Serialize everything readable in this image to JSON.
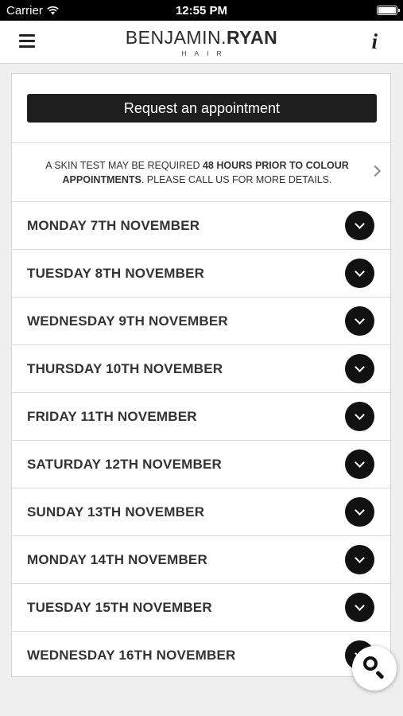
{
  "status_bar": {
    "carrier": "Carrier",
    "time": "12:55 PM"
  },
  "header": {
    "logo_first": "BENJAMIN.",
    "logo_second": "RYAN",
    "logo_sub": "HAIR",
    "info_glyph": "i"
  },
  "request": {
    "label": "Request an appointment"
  },
  "notice": {
    "part1": "A SKIN TEST MAY BE REQUIRED ",
    "bold1": "48 HOURS PRIOR TO COLOUR APPOINTMENTS",
    "part2": ". PLEASE CALL US FOR MORE DETAILS."
  },
  "days": [
    {
      "label": "MONDAY 7TH NOVEMBER"
    },
    {
      "label": "TUESDAY 8TH NOVEMBER"
    },
    {
      "label": "WEDNESDAY 9TH NOVEMBER"
    },
    {
      "label": "THURSDAY 10TH NOVEMBER"
    },
    {
      "label": "FRIDAY 11TH NOVEMBER"
    },
    {
      "label": "SATURDAY 12TH NOVEMBER"
    },
    {
      "label": "SUNDAY 13TH NOVEMBER"
    },
    {
      "label": "MONDAY 14TH NOVEMBER"
    },
    {
      "label": "TUESDAY 15TH NOVEMBER"
    },
    {
      "label": "WEDNESDAY 16TH NOVEMBER"
    }
  ],
  "icons": {
    "menu": "hamburger-icon",
    "info": "info-icon",
    "notice": "chevron-right-icon",
    "expand": "chevron-down-icon",
    "search": "search-icon",
    "wifi": "wifi-icon",
    "battery": "battery-icon"
  },
  "colors": {
    "accent": "#1e1e1e",
    "background": "#efefef",
    "card": "#ffffff"
  }
}
